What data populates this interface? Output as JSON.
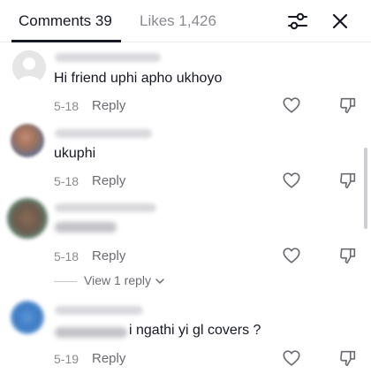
{
  "tabs": {
    "comments_label": "Comments 39",
    "likes_label": "Likes 1,426"
  },
  "icons": {
    "filter": "sliders-icon",
    "close": "close-icon",
    "like": "heart-outline-icon",
    "dislike": "thumbs-down-icon",
    "chevron": "chevron-down-icon"
  },
  "comments": [
    {
      "text": "Hi friend uphi apho ukhoyo",
      "date": "5-18",
      "reply_label": "Reply"
    },
    {
      "text": "ukuphi",
      "date": "5-18",
      "reply_label": "Reply"
    },
    {
      "text": "",
      "date": "5-18",
      "reply_label": "Reply"
    },
    {
      "text": "i ngathi yi gl covers ?",
      "date": "5-19",
      "reply_label": "Reply"
    }
  ],
  "view_replies_label": "View 1 reply",
  "colors": {
    "text_primary": "#161823",
    "text_secondary": "#8a8b91",
    "divider": "#ececec"
  }
}
